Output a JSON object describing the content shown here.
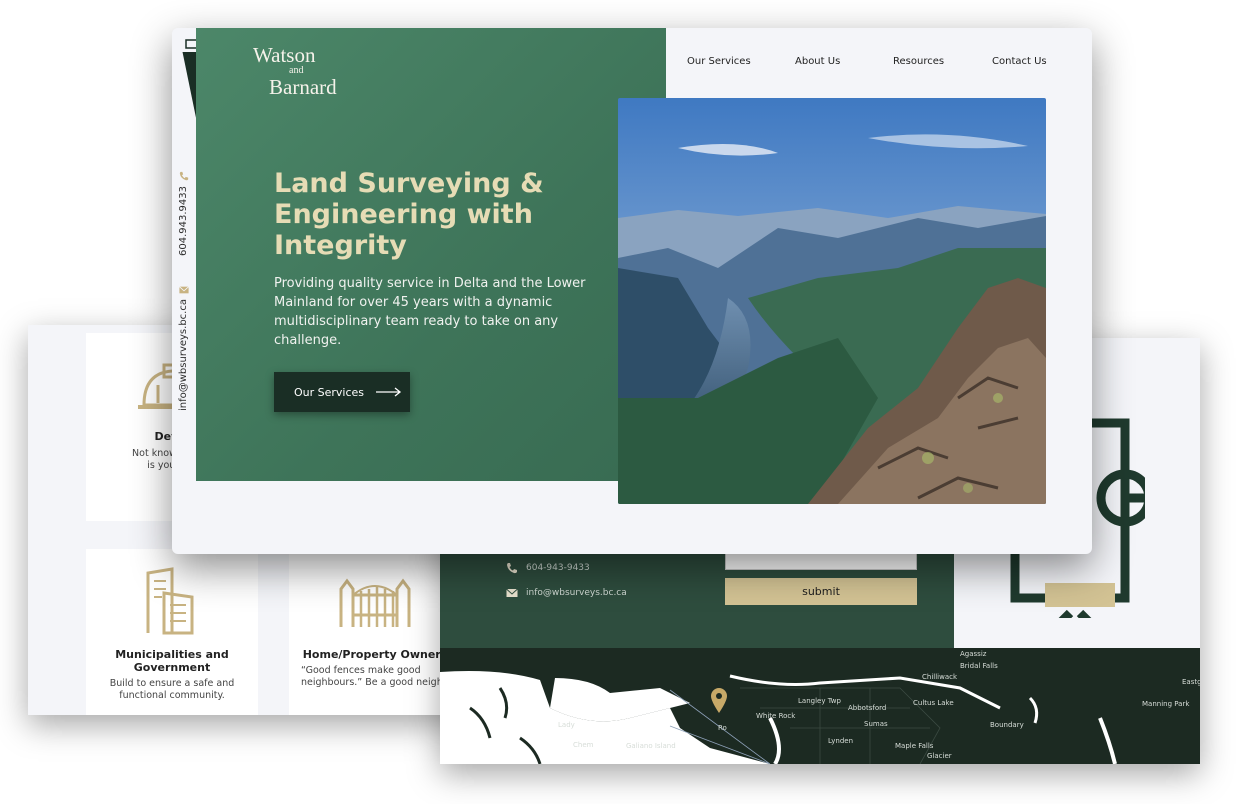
{
  "brand": {
    "line1": "Watson",
    "line2": "and",
    "line3": "Barnard",
    "colors": {
      "hero_green": "#437c60",
      "dark_green": "#1a2e25",
      "gold": "#d3c394",
      "cream": "#e6dcb5"
    }
  },
  "nav": {
    "items": [
      {
        "label": "Our Services"
      },
      {
        "label": "About Us"
      },
      {
        "label": "Resources"
      },
      {
        "label": "Contact Us"
      }
    ]
  },
  "hero": {
    "title": "Land Surveying & Engineering with Integrity",
    "subtitle": "Providing quality service in Delta and the Lower Mainland for over 45 years with a dynamic multidisciplinary team ready to take on any challenge.",
    "button_label": "Our Services",
    "button_icon": "arrow-right-icon"
  },
  "side_contact": {
    "phone": "604.943.9433",
    "email": "info@wbsurveys.bc.ca",
    "phone_icon": "phone-icon",
    "email_icon": "envelope-icon"
  },
  "audience": {
    "tiles": [
      {
        "title": "Devel",
        "desc_line1": "Not knowing you",
        "desc_line2": "is your onl",
        "icon": "hard-hat-icon"
      },
      {
        "title": "Municipalities and Government",
        "desc": "Build to ensure a safe and functional community.",
        "icon": "buildings-icon"
      },
      {
        "title": "Home/Property Owners",
        "desc": "“Good fences make good neighbours.” Be a good neighbou",
        "icon": "fence-icon"
      }
    ]
  },
  "contact": {
    "phone": "604-943-9433",
    "email": "info@wbsurveys.bc.ca",
    "submit_label": "submit"
  },
  "map": {
    "labels": {
      "agassiz": "Agassiz",
      "bridal_falls": "Bridal Falls",
      "chilliwack": "Chilliwack",
      "eastgate": "Eastg",
      "langley_twp": "Langley Twp",
      "abbotsford": "Abbotsford",
      "cultus_lake": "Cultus Lake",
      "manning_park": "Manning Park",
      "white_rock": "White Rock",
      "sumas": "Sumas",
      "boundary": "Boundary",
      "lynden": "Lynden",
      "maple_falls": "Maple Falls",
      "glacier": "Glacier",
      "ladysmith": "Lady",
      "chemainus": "Chem",
      "galiano": "Galiano Island",
      "point_roberts": "Ro"
    },
    "pin_icon": "map-pin-icon"
  }
}
